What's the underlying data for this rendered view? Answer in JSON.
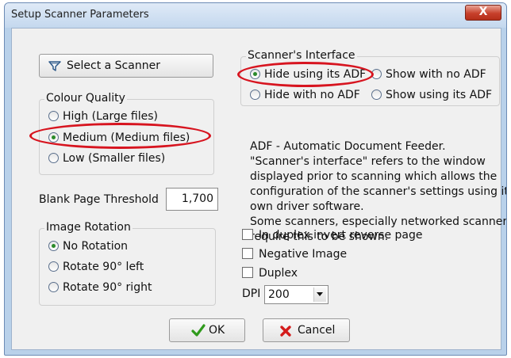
{
  "window": {
    "title": "Setup Scanner Parameters",
    "close_glyph": "X"
  },
  "select_scanner": {
    "label": "Select a Scanner",
    "icon": "scanner-icon"
  },
  "colour_quality": {
    "label": "Colour Quality",
    "options": [
      "High (Large files)",
      "Medium (Medium files)",
      "Low (Smaller files)"
    ],
    "selected": "Medium (Medium files)"
  },
  "blank_page": {
    "label": "Blank Page Threshold",
    "value": "1,700"
  },
  "image_rotation": {
    "label": "Image Rotation",
    "options": [
      "No Rotation",
      "Rotate 90° left",
      "Rotate 90° right"
    ],
    "selected": "No Rotation"
  },
  "scanner_interface": {
    "label": "Scanner's Interface",
    "options": [
      "Hide using its ADF",
      "Show with no ADF",
      "Hide with no ADF",
      "Show using its ADF"
    ],
    "selected": "Hide using its ADF"
  },
  "info_lines": [
    "ADF - Automatic Document Feeder.",
    "\"Scanner's interface\" refers to the window",
    "displayed prior to scanning which allows the",
    "configuration of the scanner's settings using its",
    "own driver software.",
    "Some scanners, especially networked scanners,",
    "require this to be shown."
  ],
  "checkboxes": {
    "duplex_invert": "In duplex invert reverse page",
    "negative": "Negative Image",
    "duplex": "Duplex"
  },
  "dpi": {
    "label": "DPI",
    "value": "200"
  },
  "buttons": {
    "ok": "OK",
    "cancel": "Cancel"
  },
  "colors": {
    "highlight": "#d7141f",
    "ok_check": "#2f9a1c",
    "cancel_x": "#d41c1c"
  }
}
